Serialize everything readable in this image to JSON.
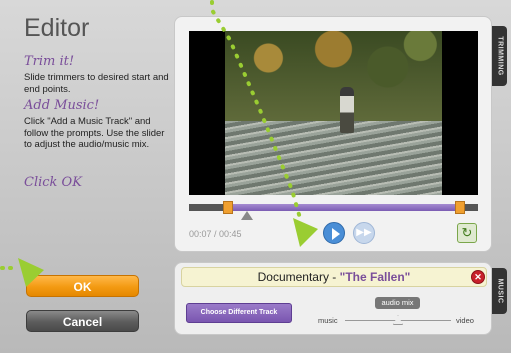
{
  "app": {
    "title": "Editor"
  },
  "steps": [
    {
      "heading": "Trim it!",
      "text": "Slide trimmers to desired start and end points."
    },
    {
      "heading": "Add Music!",
      "text": "Click \"Add a Music Track\" and follow the prompts. Use the slider to adjust the audio/music mix."
    },
    {
      "heading": "Click OK",
      "text": ""
    }
  ],
  "buttons": {
    "ok": "OK",
    "cancel": "Cancel"
  },
  "video": {
    "time_display": "00:07 / 00:45",
    "tab_label": "TRIMMING"
  },
  "music": {
    "tab_label": "MUSIC",
    "track_genre": "Documentary - ",
    "track_title": "\"The Fallen\"",
    "choose_button": "Choose Different Track",
    "mix_label": "audio mix",
    "mix_left_label": "music",
    "mix_right_label": "video"
  },
  "colors": {
    "accent_purple": "#7a56b0",
    "ok_orange": "#f39a12",
    "arrow_green": "#9acd32",
    "play_blue": "#4a8ed6"
  },
  "icons": {
    "play": "play-icon",
    "fast_forward": "fast-forward-icon",
    "refresh": "refresh-icon",
    "remove": "close-icon"
  }
}
